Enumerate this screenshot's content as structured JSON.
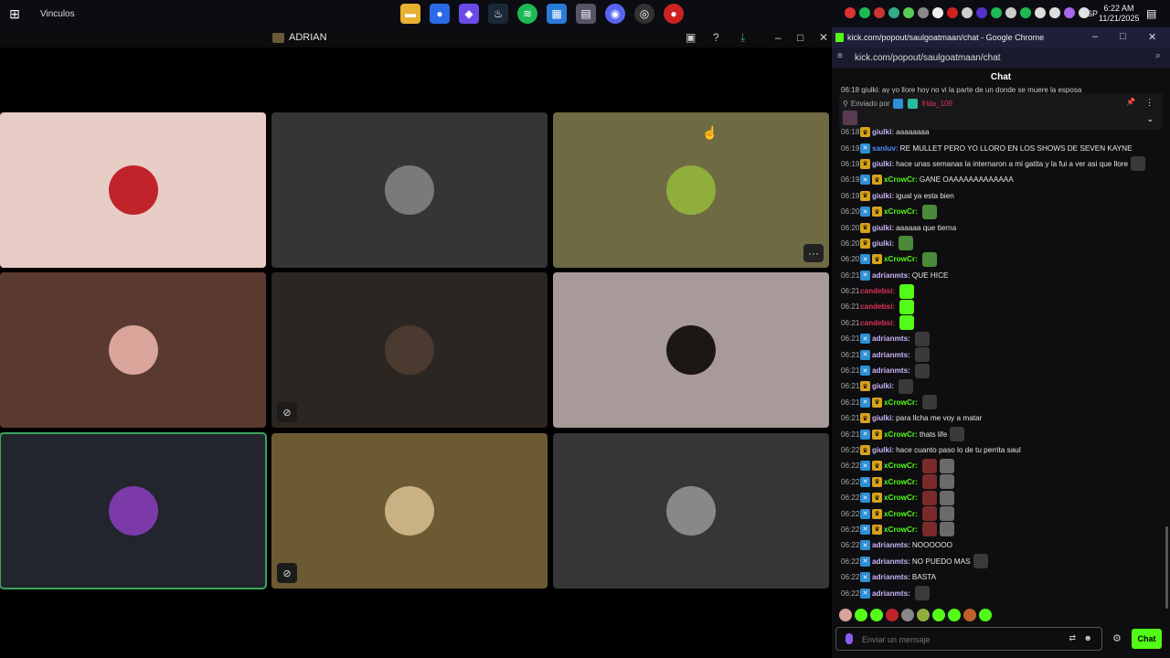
{
  "taskbar": {
    "start_glyph": "⊞",
    "label": "Vinculos",
    "lang": "ESP",
    "time": "6:22 AM",
    "date": "11/21/2025"
  },
  "discord": {
    "title": "ADRIAN",
    "tiles": [
      {
        "bg": "#e8ccc6",
        "avatar_bg": "#c0242a",
        "muted": false,
        "active": false,
        "more": false
      },
      {
        "bg": "#353535",
        "avatar_bg": "#7a7a78",
        "muted": false,
        "active": false,
        "more": false
      },
      {
        "bg": "#6e6a44",
        "avatar_bg": "#8fae3c",
        "muted": false,
        "active": false,
        "more": true
      },
      {
        "bg": "#5a3a30",
        "avatar_bg": "#d9a59a",
        "muted": false,
        "active": false,
        "more": false
      },
      {
        "bg": "#2b2622",
        "avatar_bg": "#4a3a30",
        "muted": true,
        "active": false,
        "more": false
      },
      {
        "bg": "#a89a98",
        "avatar_bg": "#1c1614",
        "muted": false,
        "active": false,
        "more": false
      },
      {
        "bg": "#22242e",
        "avatar_bg": "#7b3aa8",
        "muted": false,
        "active": true,
        "more": false
      },
      {
        "bg": "#6b5a32",
        "avatar_bg": "#c9b184",
        "muted": true,
        "active": false,
        "more": false
      },
      {
        "bg": "#363638",
        "avatar_bg": "#888",
        "muted": false,
        "active": false,
        "more": false
      }
    ]
  },
  "chrome": {
    "title": "kick.com/popout/saulgoatmaan/chat - Google Chrome",
    "url": "kick.com/popout/saulgoatmaan/chat",
    "chat_header": "Chat",
    "topline": "06:18  giulki: ay yo llore hoy no vi la parte de un donde se muere la esposa",
    "pinned_prefix": "Enviado por",
    "pinned_user": "frida_109",
    "input_placeholder": "Enviar un mensaje",
    "send_label": "Chat",
    "accent": "#53fc18"
  },
  "messages": [
    {
      "t": "06:18",
      "b": [
        "crown"
      ],
      "u": "giulki",
      "c": "#c9b3f5",
      "m": "aaaaaaaa",
      "e": []
    },
    {
      "t": "06:19",
      "b": [
        "sub"
      ],
      "u": "sanluv",
      "c": "#4a8ef0",
      "m": "RE MULLET PERO YO LLORO EN LOS SHOWS DE SEVEN KAYNE",
      "e": []
    },
    {
      "t": "06:19",
      "b": [
        "crown"
      ],
      "u": "giulki",
      "c": "#c9b3f5",
      "m": "hace unas semanas la internaron a mi gatita y la fui a ver asi que llore",
      "e": [
        "#3a3a3a"
      ]
    },
    {
      "t": "06:19",
      "b": [
        "sub",
        "crown"
      ],
      "u": "xCrowCr",
      "c": "#53fc18",
      "m": "GANE OAAAAAAAAAAAAA",
      "e": []
    },
    {
      "t": "06:19",
      "b": [
        "crown"
      ],
      "u": "giulki",
      "c": "#c9b3f5",
      "m": "igual ya esta bien",
      "e": []
    },
    {
      "t": "06:20",
      "b": [
        "sub",
        "crown"
      ],
      "u": "xCrowCr",
      "c": "#53fc18",
      "m": "",
      "e": [
        "#4a8a3a"
      ]
    },
    {
      "t": "06:20",
      "b": [
        "crown"
      ],
      "u": "giulki",
      "c": "#c9b3f5",
      "m": "aaaaaa que tierna",
      "e": []
    },
    {
      "t": "06:20",
      "b": [
        "crown"
      ],
      "u": "giulki",
      "c": "#c9b3f5",
      "m": "",
      "e": [
        "#4a8a3a"
      ]
    },
    {
      "t": "06:20",
      "b": [
        "sub",
        "crown"
      ],
      "u": "xCrowCr",
      "c": "#53fc18",
      "m": "",
      "e": [
        "#4a8a3a"
      ]
    },
    {
      "t": "06:21",
      "b": [
        "sub"
      ],
      "u": "adrianmts",
      "c": "#c9b3f5",
      "m": "QUE HICE",
      "e": []
    },
    {
      "t": "06:21",
      "b": [],
      "u": "candebsi",
      "c": "#e0335a",
      "m": "",
      "e": [
        "#53fc18"
      ]
    },
    {
      "t": "06:21",
      "b": [],
      "u": "candebsi",
      "c": "#e0335a",
      "m": "",
      "e": [
        "#53fc18"
      ]
    },
    {
      "t": "06:21",
      "b": [],
      "u": "candebsi",
      "c": "#e0335a",
      "m": "",
      "e": [
        "#53fc18"
      ]
    },
    {
      "t": "06:21",
      "b": [
        "sub"
      ],
      "u": "adrianmts",
      "c": "#c9b3f5",
      "m": "",
      "e": [
        "#3a3a3a"
      ]
    },
    {
      "t": "06:21",
      "b": [
        "sub"
      ],
      "u": "adrianmts",
      "c": "#c9b3f5",
      "m": "",
      "e": [
        "#3a3a3a"
      ]
    },
    {
      "t": "06:21",
      "b": [
        "sub"
      ],
      "u": "adrianmts",
      "c": "#c9b3f5",
      "m": "",
      "e": [
        "#3a3a3a"
      ]
    },
    {
      "t": "06:21",
      "b": [
        "crown"
      ],
      "u": "giulki",
      "c": "#c9b3f5",
      "m": "",
      "e": [
        "#3a3a3a"
      ]
    },
    {
      "t": "06:21",
      "b": [
        "sub",
        "crown"
      ],
      "u": "xCrowCr",
      "c": "#53fc18",
      "m": "",
      "e": [
        "#3a3a3a"
      ]
    },
    {
      "t": "06:21",
      "b": [
        "crown"
      ],
      "u": "giulki",
      "c": "#c9b3f5",
      "m": "para llcha me voy a matar",
      "e": []
    },
    {
      "t": "06:21",
      "b": [
        "sub",
        "crown"
      ],
      "u": "xCrowCr",
      "c": "#53fc18",
      "m": "thats life",
      "e": [
        "#3a3a3a"
      ]
    },
    {
      "t": "06:22",
      "b": [
        "crown"
      ],
      "u": "giulki",
      "c": "#c9b3f5",
      "m": "hace cuanto paso lo de tu perrita saul",
      "e": []
    },
    {
      "t": "06:22",
      "b": [
        "sub",
        "crown"
      ],
      "u": "xCrowCr",
      "c": "#53fc18",
      "m": "",
      "e": [
        "#7a2a2a",
        "#6a6a6a"
      ]
    },
    {
      "t": "06:22",
      "b": [
        "sub",
        "crown"
      ],
      "u": "xCrowCr",
      "c": "#53fc18",
      "m": "",
      "e": [
        "#7a2a2a",
        "#6a6a6a"
      ]
    },
    {
      "t": "06:22",
      "b": [
        "sub",
        "crown"
      ],
      "u": "xCrowCr",
      "c": "#53fc18",
      "m": "",
      "e": [
        "#7a2a2a",
        "#6a6a6a"
      ]
    },
    {
      "t": "06:22",
      "b": [
        "sub",
        "crown"
      ],
      "u": "xCrowCr",
      "c": "#53fc18",
      "m": "",
      "e": [
        "#7a2a2a",
        "#6a6a6a"
      ]
    },
    {
      "t": "06:22",
      "b": [
        "sub",
        "crown"
      ],
      "u": "xCrowCr",
      "c": "#53fc18",
      "m": "",
      "e": [
        "#7a2a2a",
        "#6a6a6a"
      ]
    },
    {
      "t": "06:22",
      "b": [
        "sub"
      ],
      "u": "adrianmts",
      "c": "#c9b3f5",
      "m": "NOOOOOO",
      "e": []
    },
    {
      "t": "06:22",
      "b": [
        "sub"
      ],
      "u": "adrianmts",
      "c": "#c9b3f5",
      "m": "NO PUEDO MAS",
      "e": [
        "#3a3a3a"
      ]
    },
    {
      "t": "06:22",
      "b": [
        "sub"
      ],
      "u": "adrianmts",
      "c": "#c9b3f5",
      "m": "BASTA",
      "e": []
    },
    {
      "t": "06:22",
      "b": [
        "sub"
      ],
      "u": "adrianmts",
      "c": "#c9b3f5",
      "m": "",
      "e": [
        "#3a3a3a"
      ]
    }
  ],
  "emote_bar": [
    "#d9a59a",
    "#53fc18",
    "#53fc18",
    "#c0242a",
    "#888",
    "#8fae3c",
    "#53fc18",
    "#53fc18",
    "#c0602a",
    "#53fc18"
  ]
}
